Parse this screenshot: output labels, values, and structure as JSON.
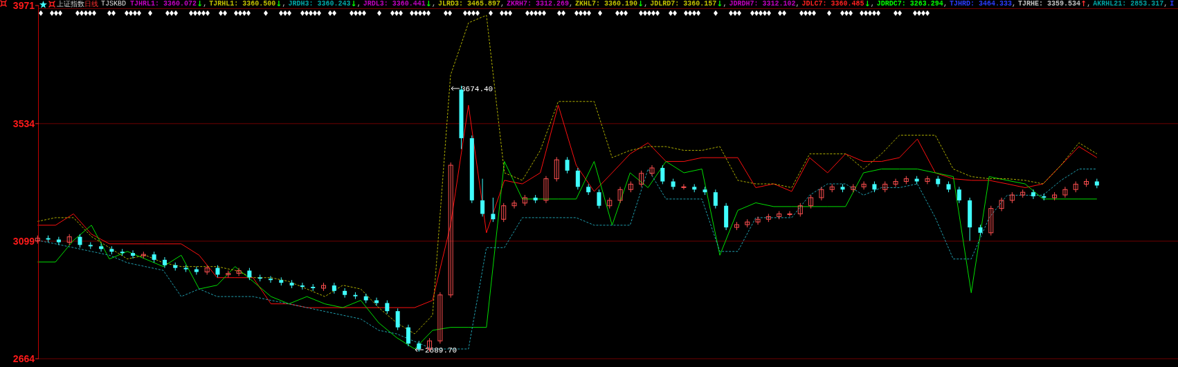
{
  "header": {
    "title": "上证指数",
    "period": "日线",
    "formula": "TJSKBD",
    "indicators": [
      {
        "label": "TJHRL1:",
        "value": "3360.072",
        "arrow": "↓",
        "rising": false,
        "separator": ",",
        "color": "#c000c0"
      },
      {
        "label": "TJRHL1:",
        "value": "3360.500",
        "arrow": "↓",
        "rising": false,
        "separator": ",",
        "color": "#c0c000"
      },
      {
        "label": "JRDH3:",
        "value": "3360.243",
        "arrow": "↓",
        "rising": false,
        "separator": ",",
        "color": "#00a8a8"
      },
      {
        "label": "JRDL3:",
        "value": "3360.441",
        "arrow": "↓",
        "rising": false,
        "separator": ",",
        "color": "#c000c0"
      },
      {
        "label": "JLRD3:",
        "value": "3465.897",
        "separator": ",",
        "color": "#c0c000"
      },
      {
        "label": "ZKRH7:",
        "value": "3312.269",
        "separator": ",",
        "color": "#c000c0"
      },
      {
        "label": "ZKHL7:",
        "value": "3360.190",
        "arrow": "↓",
        "rising": false,
        "separator": ",",
        "color": "#c0c000"
      },
      {
        "label": "JDLRD7:",
        "value": "3360.157",
        "arrow": "↓",
        "rising": false,
        "separator": ",",
        "color": "#c0c000"
      },
      {
        "label": "JDRDH7:",
        "value": "3312.102",
        "separator": ",",
        "color": "#c000c0"
      },
      {
        "label": "JDLC7:",
        "value": "3360.485",
        "arrow": "↓",
        "rising": false,
        "separator": ",",
        "color": "#ff2020"
      },
      {
        "label": "JDRDC7:",
        "value": "3263.294",
        "separator": ",",
        "color": "#00ff00"
      },
      {
        "label": "TJHRD:",
        "value": "3464.333",
        "separator": ",",
        "color": "#2a3cff"
      },
      {
        "label": "TJRHE:",
        "value": "3359.534",
        "arrow": "↑",
        "rising": true,
        "separator": ",",
        "color": "#c0c0c0"
      },
      {
        "label": "AKRHL21:",
        "value": "2853.317",
        "separator": ",",
        "color": "#00a0a0"
      },
      {
        "label": "I",
        "color": "#2a3cff"
      }
    ]
  },
  "price_chart": {
    "chart_data": {
      "type": "candlestick",
      "ylim": [
        2664,
        3971
      ],
      "yticks": [
        {
          "value": 3971,
          "label": "3971"
        },
        {
          "value": 3534,
          "label": "3534"
        },
        {
          "value": 3099,
          "label": "3099"
        },
        {
          "value": 2664,
          "label": "2664"
        }
      ],
      "ohlc": [
        [
          3100,
          3120,
          3090,
          3110
        ],
        [
          3110,
          3120,
          3095,
          3105
        ],
        [
          3105,
          3115,
          3085,
          3095
        ],
        [
          3095,
          3125,
          3085,
          3115
        ],
        [
          3115,
          3125,
          3075,
          3085
        ],
        [
          3085,
          3095,
          3070,
          3080
        ],
        [
          3080,
          3090,
          3060,
          3070
        ],
        [
          3070,
          3080,
          3050,
          3060
        ],
        [
          3060,
          3070,
          3045,
          3055
        ],
        [
          3055,
          3065,
          3035,
          3045
        ],
        [
          3045,
          3060,
          3035,
          3050
        ],
        [
          3050,
          3060,
          3020,
          3030
        ],
        [
          3030,
          3040,
          3000,
          3010
        ],
        [
          3010,
          3020,
          2990,
          3000
        ],
        [
          3000,
          3010,
          2985,
          2995
        ],
        [
          2995,
          3005,
          2975,
          2985
        ],
        [
          2985,
          3010,
          2975,
          3000
        ],
        [
          3000,
          3010,
          2965,
          2975
        ],
        [
          2975,
          2990,
          2965,
          2980
        ],
        [
          2980,
          3000,
          2970,
          2990
        ],
        [
          2990,
          3000,
          2955,
          2965
        ],
        [
          2965,
          2975,
          2950,
          2960
        ],
        [
          2960,
          2970,
          2945,
          2955
        ],
        [
          2955,
          2965,
          2935,
          2945
        ],
        [
          2945,
          2955,
          2925,
          2935
        ],
        [
          2935,
          2945,
          2920,
          2930
        ],
        [
          2930,
          2940,
          2915,
          2925
        ],
        [
          2925,
          2945,
          2915,
          2935
        ],
        [
          2935,
          2945,
          2905,
          2915
        ],
        [
          2915,
          2925,
          2890,
          2900
        ],
        [
          2900,
          2910,
          2885,
          2895
        ],
        [
          2895,
          2905,
          2870,
          2880
        ],
        [
          2880,
          2890,
          2860,
          2870
        ],
        [
          2870,
          2880,
          2830,
          2840
        ],
        [
          2840,
          2850,
          2770,
          2780
        ],
        [
          2780,
          2790,
          2710,
          2720
        ],
        [
          2720,
          2730,
          2690,
          2700
        ],
        [
          2700,
          2740,
          2690,
          2730
        ],
        [
          2730,
          2910,
          2720,
          2900
        ],
        [
          2900,
          3390,
          2890,
          3380
        ],
        [
          3660,
          3674,
          3440,
          3480
        ],
        [
          3480,
          3490,
          3240,
          3250
        ],
        [
          3250,
          3330,
          3190,
          3200
        ],
        [
          3200,
          3260,
          3170,
          3180
        ],
        [
          3180,
          3240,
          3170,
          3230
        ],
        [
          3230,
          3250,
          3220,
          3240
        ],
        [
          3240,
          3270,
          3230,
          3260
        ],
        [
          3260,
          3270,
          3240,
          3250
        ],
        [
          3250,
          3340,
          3240,
          3330
        ],
        [
          3330,
          3410,
          3320,
          3400
        ],
        [
          3400,
          3410,
          3350,
          3360
        ],
        [
          3360,
          3370,
          3290,
          3300
        ],
        [
          3300,
          3310,
          3270,
          3280
        ],
        [
          3280,
          3290,
          3220,
          3230
        ],
        [
          3230,
          3260,
          3220,
          3250
        ],
        [
          3250,
          3300,
          3240,
          3290
        ],
        [
          3290,
          3320,
          3280,
          3310
        ],
        [
          3310,
          3360,
          3300,
          3350
        ],
        [
          3350,
          3380,
          3340,
          3370
        ],
        [
          3370,
          3380,
          3310,
          3320
        ],
        [
          3320,
          3330,
          3290,
          3300
        ],
        [
          3300,
          3310,
          3290,
          3300
        ],
        [
          3300,
          3310,
          3280,
          3290
        ],
        [
          3290,
          3300,
          3270,
          3280
        ],
        [
          3280,
          3290,
          3220,
          3230
        ],
        [
          3230,
          3240,
          3140,
          3150
        ],
        [
          3150,
          3170,
          3140,
          3160
        ],
        [
          3160,
          3180,
          3150,
          3170
        ],
        [
          3170,
          3190,
          3160,
          3180
        ],
        [
          3180,
          3200,
          3170,
          3190
        ],
        [
          3190,
          3210,
          3180,
          3200
        ],
        [
          3200,
          3210,
          3190,
          3200
        ],
        [
          3200,
          3240,
          3190,
          3230
        ],
        [
          3230,
          3270,
          3220,
          3260
        ],
        [
          3260,
          3300,
          3250,
          3290
        ],
        [
          3290,
          3310,
          3280,
          3300
        ],
        [
          3300,
          3310,
          3280,
          3290
        ],
        [
          3290,
          3310,
          3280,
          3300
        ],
        [
          3300,
          3320,
          3290,
          3310
        ],
        [
          3310,
          3320,
          3280,
          3290
        ],
        [
          3290,
          3320,
          3280,
          3310
        ],
        [
          3310,
          3330,
          3300,
          3320
        ],
        [
          3320,
          3340,
          3310,
          3330
        ],
        [
          3330,
          3340,
          3310,
          3320
        ],
        [
          3320,
          3340,
          3310,
          3330
        ],
        [
          3330,
          3340,
          3300,
          3310
        ],
        [
          3310,
          3320,
          3280,
          3290
        ],
        [
          3290,
          3300,
          3240,
          3250
        ],
        [
          3250,
          3260,
          3100,
          3150
        ],
        [
          3150,
          3160,
          3120,
          3130
        ],
        [
          3130,
          3230,
          3120,
          3220
        ],
        [
          3220,
          3260,
          3210,
          3250
        ],
        [
          3250,
          3280,
          3240,
          3270
        ],
        [
          3270,
          3290,
          3260,
          3280
        ],
        [
          3280,
          3290,
          3255,
          3265
        ],
        [
          3265,
          3275,
          3250,
          3260
        ],
        [
          3260,
          3280,
          3250,
          3270
        ],
        [
          3270,
          3300,
          3260,
          3290
        ],
        [
          3290,
          3320,
          3280,
          3310
        ],
        [
          3310,
          3330,
          3300,
          3320
        ],
        [
          3320,
          3330,
          3295,
          3305
        ]
      ]
    }
  },
  "indicator_lines": {
    "chart_data": {
      "type": "line",
      "ylim": [
        2664,
        3971
      ],
      "series": [
        {
          "color": "#ff1010",
          "line_style": "solid",
          "values": [
            3158,
            3158,
            3200,
            3125,
            3089,
            3089,
            3089,
            3089,
            3089,
            3047,
            2964,
            2964,
            2964,
            2867,
            2867,
            2853,
            2853,
            2853,
            2853,
            2853,
            2853,
            2853,
            2880,
            3158,
            3602,
            3130,
            3324,
            3311,
            3352,
            3602,
            3380,
            3283,
            3352,
            3422,
            3463,
            3394,
            3394,
            3408,
            3408,
            3408,
            3297,
            3311,
            3283,
            3408,
            3352,
            3422,
            3394,
            3394,
            3408,
            3477,
            3352,
            3330,
            3324,
            3324,
            3311,
            3297,
            3311,
            3380,
            3449,
            3408
          ]
        },
        {
          "color": "#00e000",
          "line_style": "solid",
          "values": [
            3022,
            3022,
            3102,
            3158,
            3033,
            3061,
            3033,
            3005,
            3047,
            2922,
            2936,
            3005,
            2950,
            2894,
            2867,
            2894,
            2867,
            2853,
            2880,
            2797,
            2742,
            2700,
            2769,
            2780,
            2780,
            2780,
            3394,
            3255,
            3255,
            3255,
            3255,
            3394,
            3158,
            3352,
            3297,
            3394,
            3352,
            3366,
            3047,
            3213,
            3241,
            3227,
            3227,
            3227,
            3227,
            3227,
            3352,
            3366,
            3366,
            3366,
            3352,
            3338,
            2908,
            3338,
            3324,
            3311,
            3255,
            3255,
            3255,
            3255
          ]
        },
        {
          "color": "#b0b000",
          "line_style": "dashed",
          "values": [
            3172,
            3186,
            3186,
            3116,
            3075,
            3033,
            3047,
            3019,
            3005,
            3005,
            3005,
            2991,
            2964,
            2964,
            2950,
            2922,
            2894,
            2936,
            2922,
            2853,
            2797,
            2756,
            2825,
            3713,
            3907,
            3935,
            3352,
            3324,
            3435,
            3616,
            3616,
            3616,
            3408,
            3435,
            3449,
            3449,
            3435,
            3435,
            3449,
            3324,
            3311,
            3311,
            3297,
            3422,
            3422,
            3422,
            3366,
            3422,
            3491,
            3491,
            3491,
            3366,
            3338,
            3330,
            3330,
            3324,
            3311,
            3380,
            3463,
            3422
          ]
        },
        {
          "color": "#20a0b0",
          "line_style": "dashed",
          "values": [
            3102,
            3089,
            3075,
            3061,
            3047,
            3019,
            3005,
            2991,
            2894,
            2922,
            2894,
            2894,
            2894,
            2880,
            2867,
            2853,
            2839,
            2825,
            2811,
            2769,
            2756,
            2728,
            2700,
            2700,
            2700,
            3075,
            3075,
            3186,
            3186,
            3186,
            3186,
            3158,
            3158,
            3158,
            3366,
            3255,
            3255,
            3255,
            3061,
            3061,
            3186,
            3186,
            3186,
            3269,
            3311,
            3311,
            3269,
            3297,
            3297,
            3311,
            3186,
            3033,
            3033,
            3186,
            3269,
            3269,
            3269,
            3324,
            3366,
            3366
          ]
        }
      ]
    }
  },
  "annotations": [
    {
      "text": "3674.40"
    },
    {
      "text": "2689.70"
    }
  ]
}
